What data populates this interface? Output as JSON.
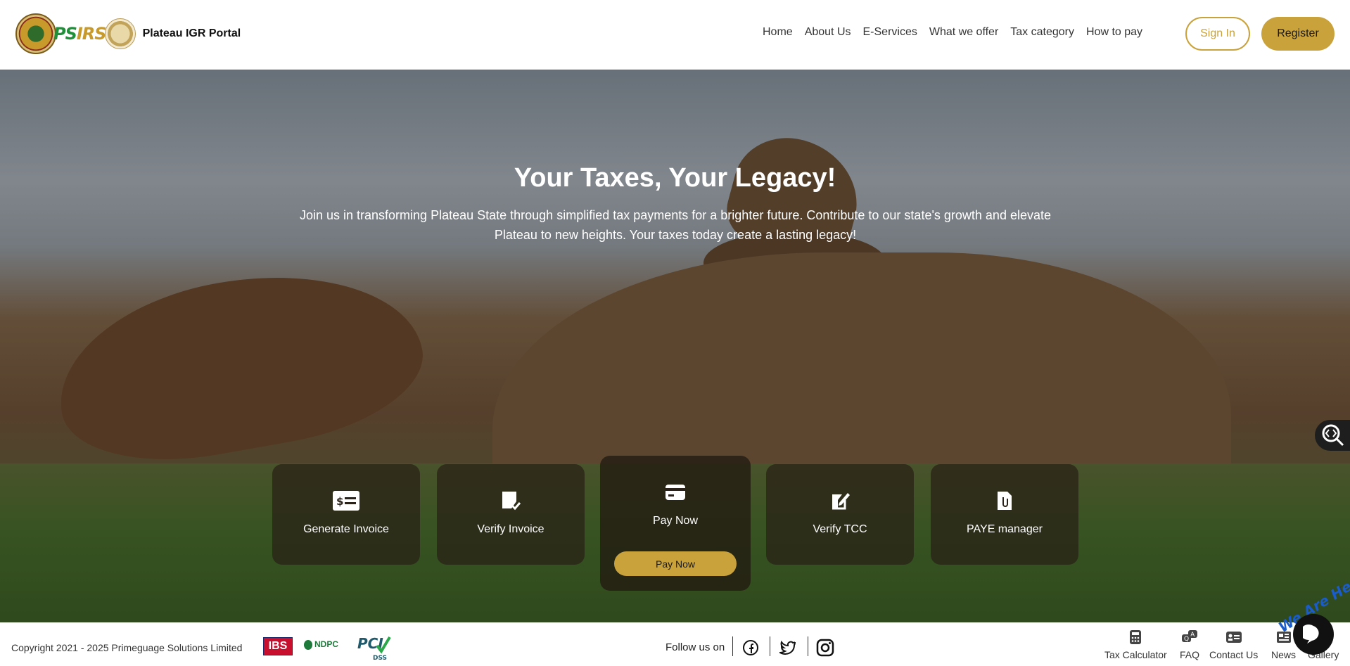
{
  "header": {
    "brand_name": "Plateau IGR Portal",
    "logo_text_a": "PS",
    "logo_text_b": "IRS",
    "nav": [
      "Home",
      "About Us",
      "E-Services",
      "What we offer",
      "Tax category",
      "How to pay"
    ],
    "signin_label": "Sign In",
    "register_label": "Register",
    "accent_color": "#c9a23c"
  },
  "hero": {
    "title": "Your Taxes, Your Legacy!",
    "subtitle": "Join us in transforming Plateau State through simplified tax payments for a brighter future.  Contribute to our state's growth and elevate Plateau to new heights.  Your taxes today create a lasting legacy!",
    "cards": [
      {
        "label": "Generate Invoice",
        "icon": "invoice-dollar-icon"
      },
      {
        "label": "Verify Invoice",
        "icon": "verify-document-icon"
      },
      {
        "label": "Pay Now",
        "icon": "credit-card-icon",
        "button": "Pay Now"
      },
      {
        "label": "Verify TCC",
        "icon": "edit-document-icon"
      },
      {
        "label": "PAYE manager",
        "icon": "file-attachment-icon"
      }
    ]
  },
  "footer": {
    "copyright": "Copyright 2021 - 2025 Primeguage Solutions Limited",
    "partner_ibs": "IBS",
    "partner_ndpc": "NDPC",
    "partner_pci": "PCI",
    "partner_pci_sub": "DSS",
    "follow_label": "Follow us on",
    "social": [
      "facebook-icon",
      "twitter-icon",
      "instagram-icon"
    ],
    "links": [
      "Tax Calculator",
      "FAQ",
      "Contact Us",
      "News",
      "Gallery"
    ],
    "chat_banner": "We Are Here!",
    "chat_close": "×"
  }
}
